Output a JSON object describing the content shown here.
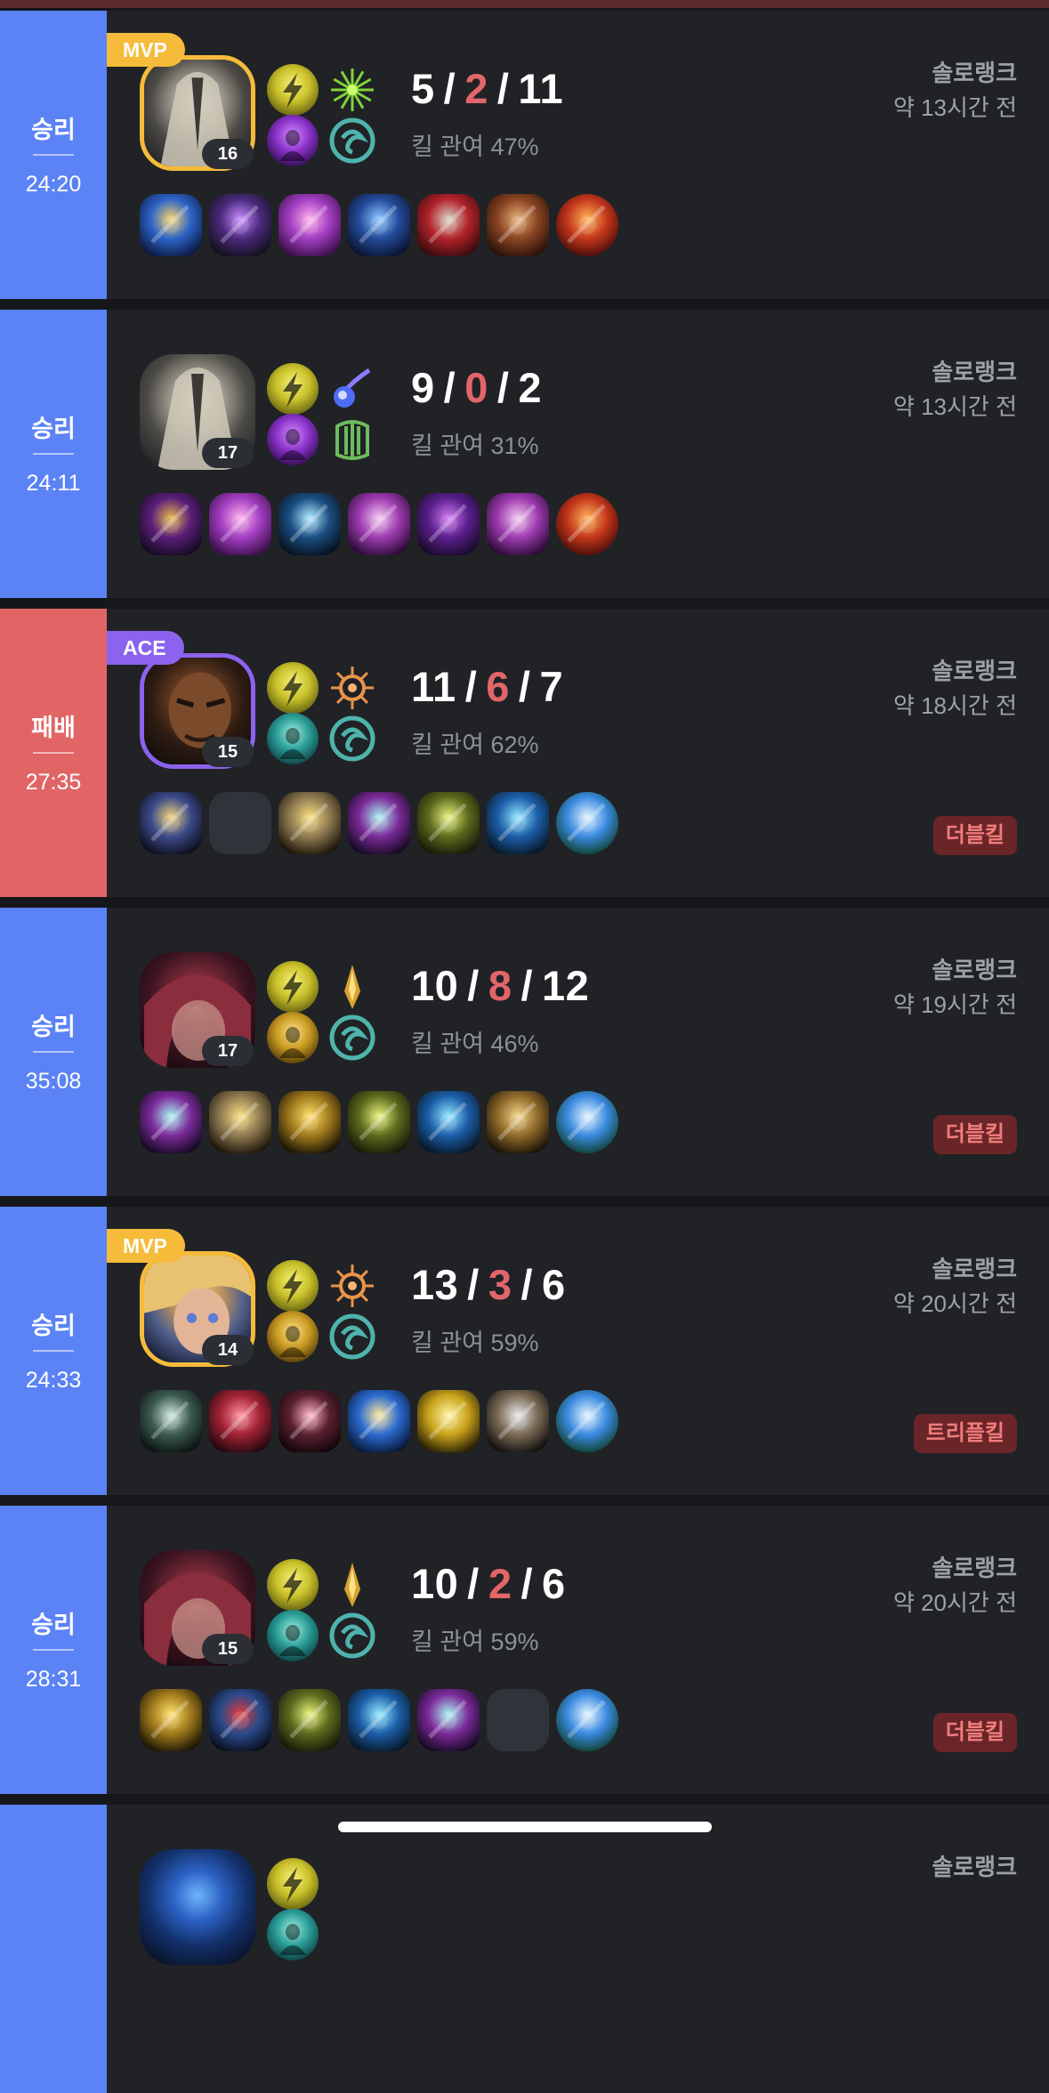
{
  "colors": {
    "win": "#5b83f5",
    "loss": "#e16565",
    "death": "#e2656a",
    "mvp": "#f6bb3a",
    "ace": "#8b63ee",
    "multikill_bg": "#6a2528",
    "multikill_text": "#f07c7c"
  },
  "matches": [
    {
      "result": "승리",
      "outcome": "win",
      "duration": "24:20",
      "badge": "MVP",
      "champion": "silver-helmet-champion",
      "level": "16",
      "spells": [
        "flash-spell-icon",
        "purple-ghost-spell-icon"
      ],
      "runes": [
        "green-spark-rune-icon",
        "teal-swirl-rune-icon"
      ],
      "kills": "5",
      "deaths": "2",
      "assists": "11",
      "kill_participation": "킬 관여 47%",
      "queue": "솔로랭크",
      "time_ago": "약 13시간 전",
      "multikill": "",
      "items": [
        "hourglass-item-icon",
        "purple-staff-item-icon",
        "spellbook-item-icon",
        "blue-ring-item-icon",
        "boots-item-icon",
        "tome-item-icon",
        "red-lens-trinket-icon"
      ]
    },
    {
      "result": "승리",
      "outcome": "win",
      "duration": "24:11",
      "badge": "",
      "champion": "silver-helmet-champion",
      "level": "17",
      "spells": [
        "flash-spell-icon",
        "purple-ghost-spell-icon"
      ],
      "runes": [
        "blue-comet-rune-icon",
        "green-pillars-rune-icon"
      ],
      "kills": "9",
      "deaths": "0",
      "assists": "2",
      "kill_participation": "킬 관여 31%",
      "queue": "솔로랭크",
      "time_ago": "약 13시간 전",
      "multikill": "",
      "items": [
        "purple-mask-item-icon",
        "spellbook-item-icon",
        "dark-tree-item-icon",
        "pink-orb-item-icon",
        "violet-boots-item-icon",
        "pink-orb-item-icon",
        "red-lens-trinket-icon"
      ]
    },
    {
      "result": "패배",
      "outcome": "loss",
      "duration": "27:35",
      "badge": "ACE",
      "champion": "dark-hero-champion",
      "level": "15",
      "spells": [
        "flash-spell-icon",
        "teal-heal-spell-icon"
      ],
      "runes": [
        "orange-sun-rune-icon",
        "teal-swirl-rune-icon"
      ],
      "kills": "11",
      "deaths": "6",
      "assists": "7",
      "kill_participation": "킬 관여 62%",
      "queue": "솔로랭크",
      "time_ago": "약 18시간 전",
      "multikill": "더블킬",
      "items": [
        "crossbow-item-icon",
        "empty-slot",
        "greaves-item-icon",
        "scythe-item-icon",
        "crossed-blades-item-icon",
        "blue-axe-item-icon",
        "blue-orb-trinket-icon"
      ]
    },
    {
      "result": "승리",
      "outcome": "win",
      "duration": "35:08",
      "badge": "",
      "champion": "red-hair-champion",
      "level": "17",
      "spells": [
        "flash-spell-icon",
        "gold-heal-spell-icon"
      ],
      "runes": [
        "gold-arrow-rune-icon",
        "teal-swirl-rune-icon"
      ],
      "kills": "10",
      "deaths": "8",
      "assists": "12",
      "kill_participation": "킬 관여 46%",
      "queue": "솔로랭크",
      "time_ago": "약 19시간 전",
      "multikill": "더블킬",
      "items": [
        "scythe-item-icon",
        "greaves-item-icon",
        "gold-blade-item-icon",
        "crossed-blades-item-icon",
        "blue-axe-item-icon",
        "gold-armor-item-icon",
        "blue-orb-trinket-icon"
      ]
    },
    {
      "result": "승리",
      "outcome": "win",
      "duration": "24:33",
      "badge": "MVP",
      "champion": "blonde-champion",
      "level": "14",
      "spells": [
        "flash-spell-icon",
        "gold-heal-spell-icon"
      ],
      "runes": [
        "orange-sun-rune-icon",
        "teal-swirl-rune-icon"
      ],
      "kills": "13",
      "deaths": "3",
      "assists": "6",
      "kill_participation": "킬 관여 59%",
      "queue": "솔로랭크",
      "time_ago": "약 20시간 전",
      "multikill": "트리플킬",
      "items": [
        "pickaxe-item-icon",
        "red-claw-item-icon",
        "dagger-item-icon",
        "trident-item-icon",
        "gold-bow-item-icon",
        "drill-item-icon",
        "blue-orb-trinket-icon"
      ]
    },
    {
      "result": "승리",
      "outcome": "win",
      "duration": "28:31",
      "badge": "",
      "champion": "red-hair-champion",
      "level": "15",
      "spells": [
        "flash-spell-icon",
        "teal-heal-spell-icon"
      ],
      "runes": [
        "gold-arrow-rune-icon",
        "teal-swirl-rune-icon"
      ],
      "kills": "10",
      "deaths": "2",
      "assists": "6",
      "kill_participation": "킬 관여 59%",
      "queue": "솔로랭크",
      "time_ago": "약 20시간 전",
      "multikill": "더블킬",
      "items": [
        "gold-blade-item-icon",
        "knight-helm-item-icon",
        "crossed-blades-item-icon",
        "blue-axe-item-icon",
        "scythe-item-icon",
        "empty-slot",
        "blue-orb-trinket-icon"
      ]
    },
    {
      "result": "",
      "outcome": "win",
      "duration": "",
      "badge": "",
      "champion": "blue-hair-champion",
      "level": "",
      "spells": [
        "flash-spell-icon",
        "teal-heal-spell-icon"
      ],
      "runes": [
        "",
        ""
      ],
      "kills": "",
      "deaths": "",
      "assists": "",
      "kill_participation": "",
      "queue": "솔로랭크",
      "time_ago": "",
      "multikill": "",
      "items": []
    }
  ]
}
